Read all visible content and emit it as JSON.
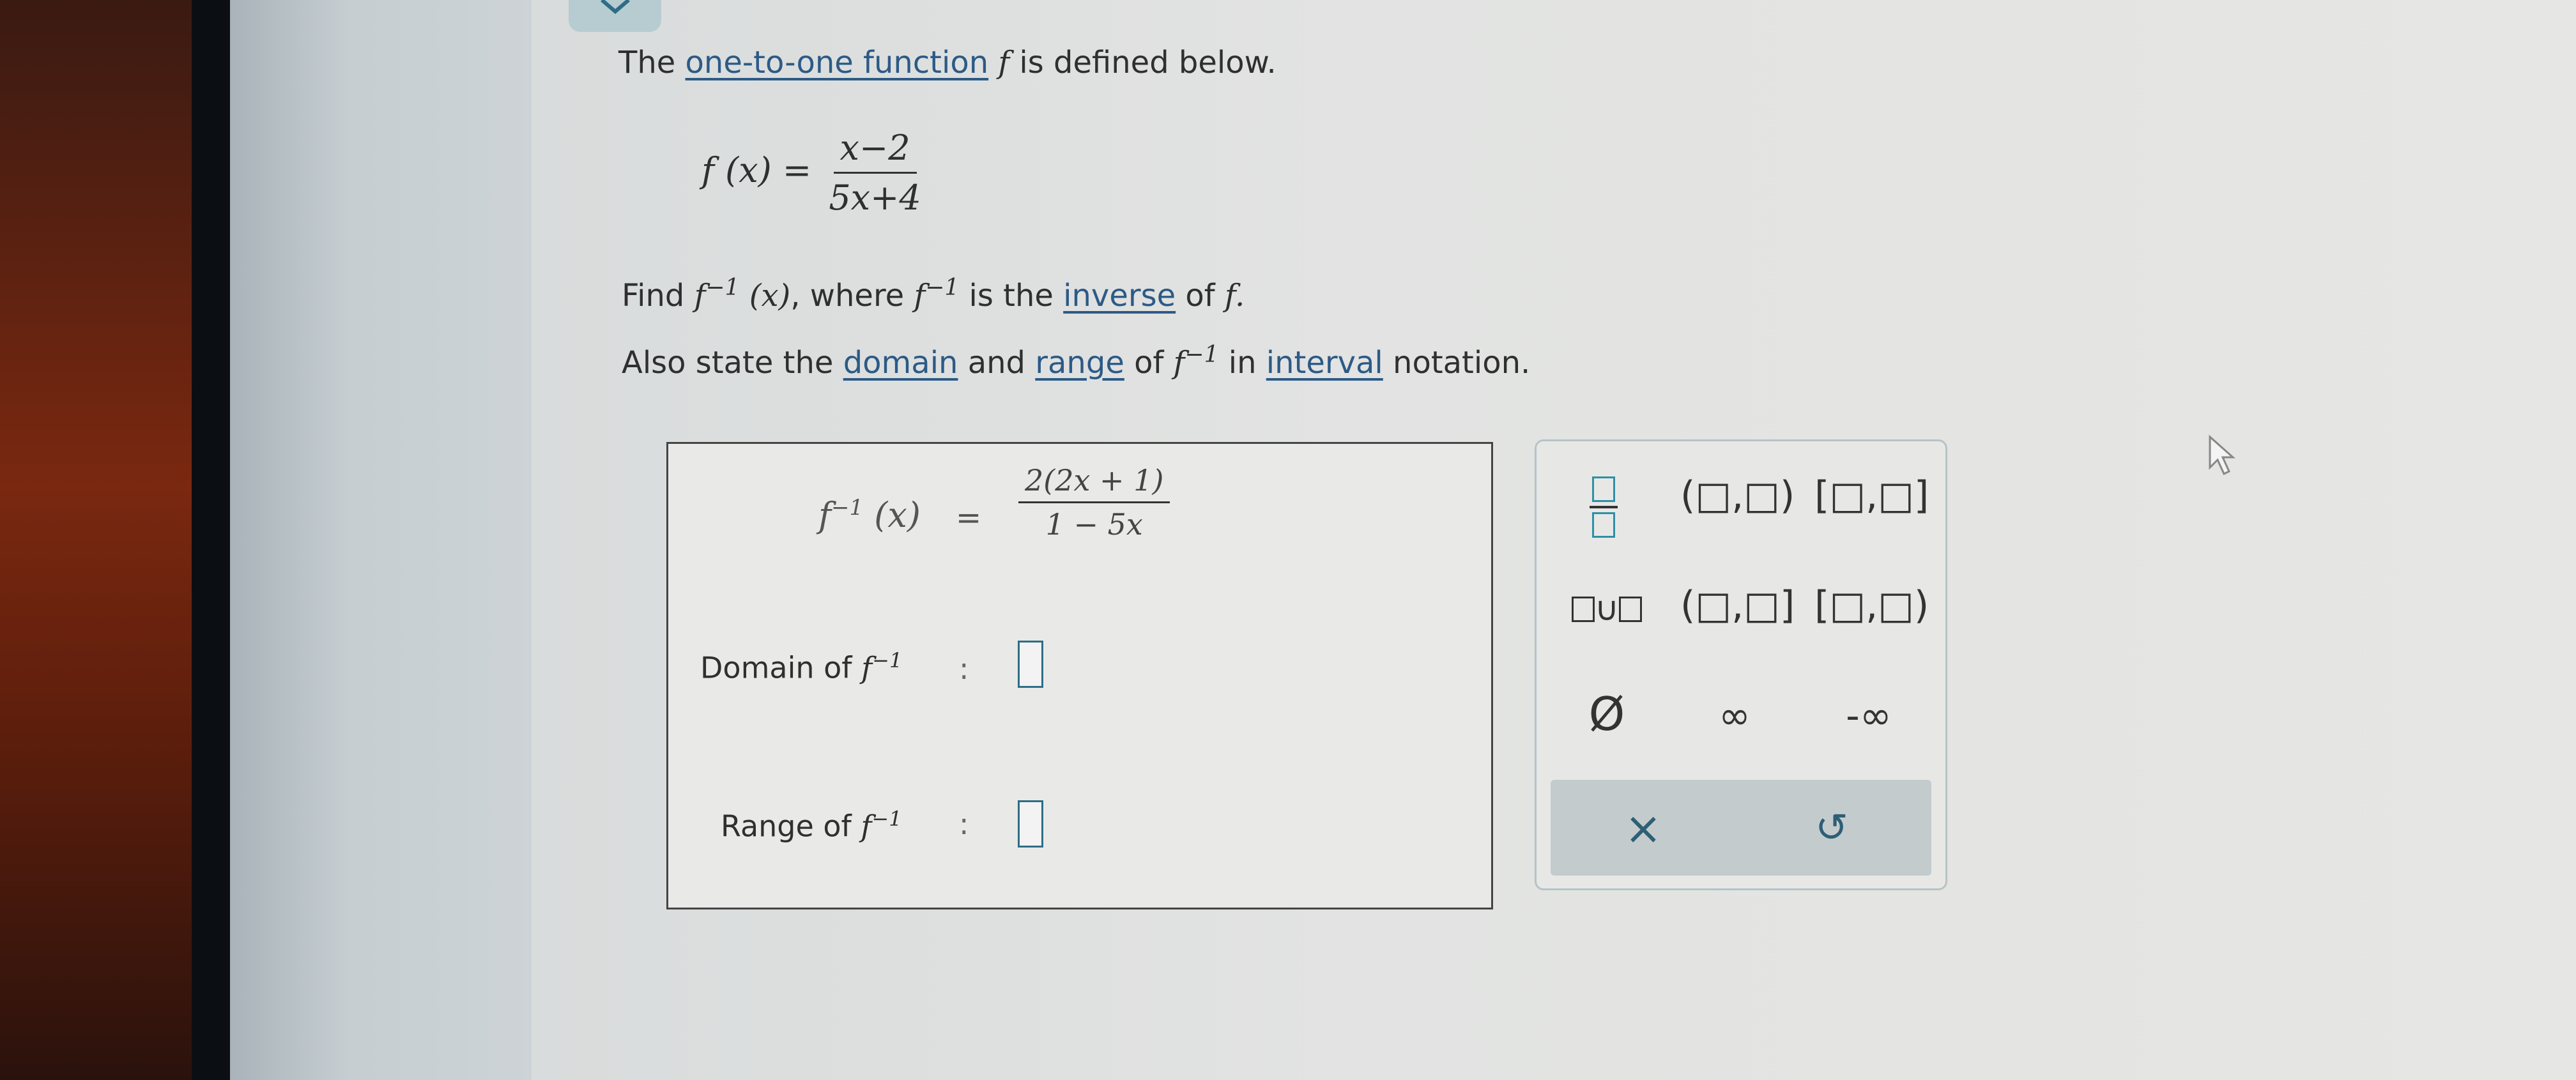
{
  "problem": {
    "intro_pre": "The ",
    "intro_link": "one-to-one function",
    "intro_f": " f",
    "intro_post": " is defined below.",
    "fx_lhs": "f (x) =",
    "fx_num": "x−2",
    "fx_den": "5x+4",
    "find_pre": "Find ",
    "find_f": "f",
    "find_sup": "−1",
    "find_x": " (x)",
    "find_where": ", where ",
    "find_f2": "f",
    "find_sup2": "−1",
    "find_is": " is the ",
    "find_link": "inverse",
    "find_of": " of ",
    "find_f3": "f.",
    "also_pre": "Also state the ",
    "also_domain": "domain",
    "also_and": " and ",
    "also_range": "range",
    "also_of": " of ",
    "also_f": "f",
    "also_sup": "−1",
    "also_in": " in ",
    "also_interval": "interval",
    "also_post": " notation."
  },
  "answer": {
    "finv_f": "f",
    "finv_sup": "−1",
    "finv_x": "(x)",
    "equals": "=",
    "num": "2(2x + 1)",
    "den": "1 − 5x",
    "domain_label": "Domain of ",
    "domain_f": "f",
    "domain_sup": "−1",
    "range_label": "Range of ",
    "range_f": "f",
    "range_sup": "−1",
    "colon": ":"
  },
  "keypad": {
    "union": "∪",
    "open_open": "(□,□)",
    "closed_closed": "[□,□]",
    "open_closed": "(□,□]",
    "closed_open": "[□,□)",
    "empty_set": "Ø",
    "infinity": "∞",
    "neg_infinity": "-∞",
    "clear": "×",
    "undo": "↺"
  },
  "colors": {
    "link": "#2c5a86",
    "box_teal": "#2f8fa6",
    "panel_border": "#b6c3c7"
  }
}
